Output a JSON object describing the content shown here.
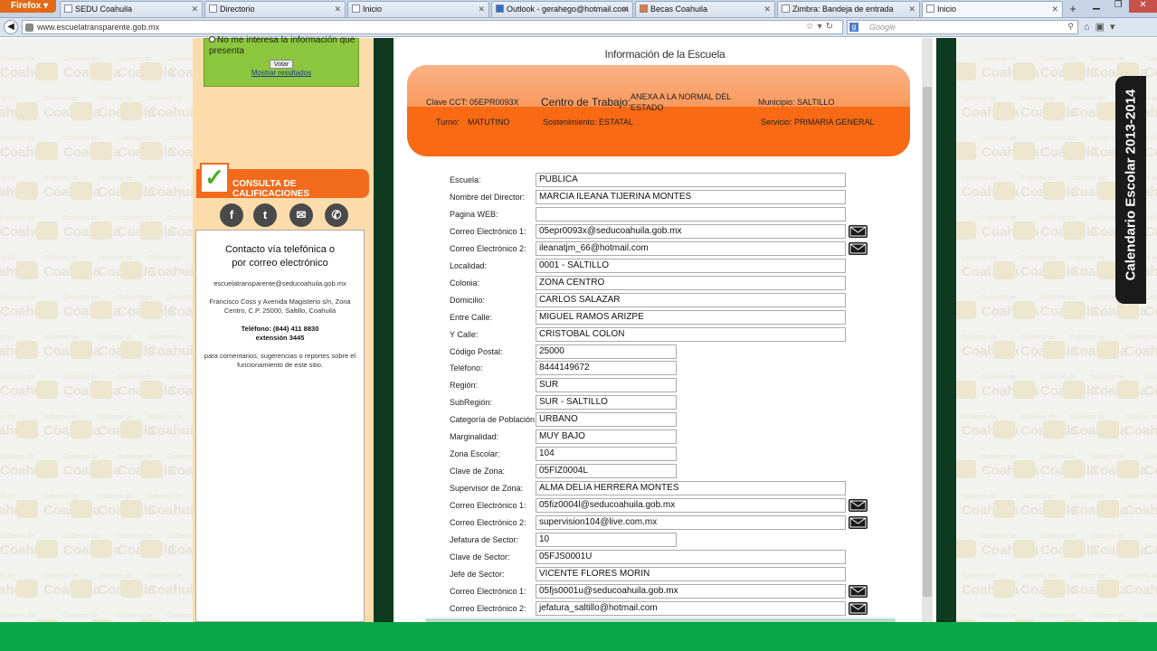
{
  "browser": {
    "menu_label": "Firefox ▾",
    "tabs": [
      {
        "label": "SEDU Coahuila"
      },
      {
        "label": "Directorio"
      },
      {
        "label": "Inicio"
      },
      {
        "label": "Outlook - gerahego@hotmail.com"
      },
      {
        "label": "Becas Coahuila"
      },
      {
        "label": "Zimbra: Bandeja de entrada"
      },
      {
        "label": "Inicio"
      }
    ],
    "url": "www.escuelatransparente.gob.mx",
    "search_placeholder": "Google"
  },
  "sidebar": {
    "poll_text": "No me interesa la información que presenta",
    "vote_label": "Votar",
    "show_results_label": "Mostrar resultados",
    "consulta_label": "CONSULTA DE CALIFICACIONES",
    "contact_title_1": "Contacto vía telefónica o",
    "contact_title_2": "por correo electrónico",
    "contact_email": "escuelatransparente@seducoahuila.gob.mx",
    "contact_address": "Francisco Coss y Avenida Magisterio s/n, Zona Centro, C.P. 25000, Saltillo, Coahuila",
    "contact_phone": "Teléfono: (844) 411 8830",
    "contact_ext": "extensión 3445",
    "contact_note": "para comentarios, sugerencias o reportes sobre el funcionamiento de este sitio."
  },
  "watermark_text": "Coahuila",
  "watermark_small": "Gobierno de",
  "calendar_tab": "Calendario Escolar 2013-2014",
  "school": {
    "title": "Información de la Escuela",
    "clave_cct": "Clave CCT: 05EPR0093X",
    "centro_label": "Centro de Trabajo:",
    "centro_value": "ANEXA A LA NORMAL DEL ESTADO",
    "municipio": "Municipio:  SALTILLO",
    "turno_label": "Turno:",
    "turno_value": "MATUTINO",
    "sostenimiento": "Sostenimiento:  ESTATAL",
    "servicio": "Servicio:  PRIMARIA GENERAL"
  },
  "fields": [
    {
      "label": "Escuela:",
      "value": "PUBLICA"
    },
    {
      "label": "Nombre del Director:",
      "value": "MARCIA  ILEANA TIJERINA MONTES"
    },
    {
      "label": "Pagina WEB:",
      "value": ""
    },
    {
      "label": "Correo Electrónico 1:",
      "value": "05epr0093x@seducoahuila.gob.mx"
    },
    {
      "label": "Correo Electrónico 2:",
      "value": "ileanatjm_66@hotmail.com"
    },
    {
      "label": "Localidad:",
      "value": "0001 - SALTILLO"
    },
    {
      "label": "Colonia:",
      "value": "ZONA CENTRO"
    },
    {
      "label": "Domicilio:",
      "value": "CARLOS SALAZAR"
    },
    {
      "label": "Entre Calle:",
      "value": "MIGUEL RAMOS ARIZPE"
    },
    {
      "label": "Y Calle:",
      "value": "CRISTOBAL COLON"
    },
    {
      "label": "Código Postal:",
      "value": "25000"
    },
    {
      "label": "Teléfono:",
      "value": "8444149672"
    },
    {
      "label": "Región:",
      "value": "SUR"
    },
    {
      "label": "SubRegión:",
      "value": "SUR - SALTILLO"
    },
    {
      "label": "Categoría de Población:",
      "value": "URBANO"
    },
    {
      "label": "Marginalidad:",
      "value": "MUY BAJO"
    },
    {
      "label": "Zona Escolar:",
      "value": "104"
    },
    {
      "label": "Clave de Zona:",
      "value": "05FIZ0004L"
    },
    {
      "label": "Supervisor de Zona:",
      "value": "ALMA DELIA HERRERA MONTES"
    },
    {
      "label": "Correo Electrónico 1:",
      "value": "05fiz0004l@seducoahuila.gob.mx"
    },
    {
      "label": "Correo Electrónico 2:",
      "value": "supervision104@live.com.mx"
    },
    {
      "label": "Jefatura de Sector:",
      "value": "10"
    },
    {
      "label": "Clave de Sector:",
      "value": "05FJS0001U"
    },
    {
      "label": "Jefe de Sector:",
      "value": "VICENTE FLORES MORIN"
    },
    {
      "label": "Correo Electrónico 1:",
      "value": "05fjs0001u@seducoahuila.gob.mx"
    },
    {
      "label": "Correo Electrónico 2:",
      "value": "jefatura_saltillo@hotmail.com"
    }
  ]
}
